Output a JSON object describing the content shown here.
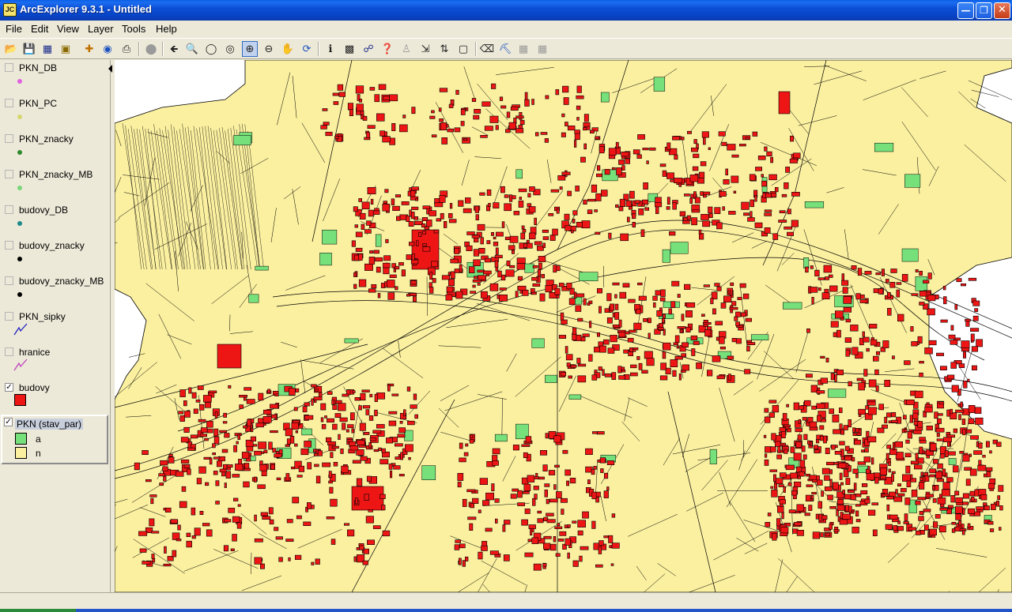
{
  "window": {
    "title": "ArcExplorer 9.3.1 - Untitled",
    "icon_text": "JC",
    "controls": {
      "minimize": "minimize",
      "maximize": "maximize",
      "close": "close"
    }
  },
  "menu": [
    "File",
    "Edit",
    "View",
    "Layer",
    "Tools",
    "Help"
  ],
  "toolbar": [
    "open-folder-icon",
    "save-icon",
    "save-as-icon",
    "layer-add-icon",
    "add-data-icon",
    "internet-icon",
    "print-icon",
    "stop-icon",
    "back-icon",
    "zoom-full-icon",
    "zoom-layer-icon",
    "zoom-selection-icon",
    "zoom-in-icon",
    "zoom-out-icon",
    "pan-icon",
    "refresh-icon",
    "identify-icon",
    "select-icon",
    "find-icon",
    "query-icon",
    "locate-icon",
    "measure-icon",
    "hyperlink-icon",
    "buffer-icon",
    "clear-icon",
    "zoom-tool-icon",
    "grid-icon",
    "table-icon"
  ],
  "colors": {
    "parcel_a": "#76e07a",
    "parcel_n": "#fbf0a0",
    "building": "#ee1515",
    "outline": "#000000"
  },
  "layers": [
    {
      "name": "PKN_DB",
      "checked": false,
      "symbol": "dot",
      "color": "#e060e0"
    },
    {
      "name": "PKN_PC",
      "checked": false,
      "symbol": "dot",
      "color": "#d6d670"
    },
    {
      "name": "PKN_znacky",
      "checked": false,
      "symbol": "dot",
      "color": "#2c8a2c"
    },
    {
      "name": "PKN_znacky_MB",
      "checked": false,
      "symbol": "dot",
      "color": "#7ad67a"
    },
    {
      "name": "budovy_DB",
      "checked": false,
      "symbol": "dot",
      "color": "#1a8a8a"
    },
    {
      "name": "budovy_znacky",
      "checked": false,
      "symbol": "dot",
      "color": "#000000"
    },
    {
      "name": "budovy_znacky_MB",
      "checked": false,
      "symbol": "dot",
      "color": "#000000"
    },
    {
      "name": "PKN_sipky",
      "checked": false,
      "symbol": "line",
      "color": "#2020c0"
    },
    {
      "name": "hranice",
      "checked": false,
      "symbol": "line",
      "color": "#c040c0"
    },
    {
      "name": "budovy",
      "checked": true,
      "symbol": "square",
      "color": "#ee1515"
    }
  ],
  "active_layer": {
    "name": "PKN (stav_par)",
    "checked": true,
    "classes": [
      {
        "label": "a",
        "color": "#76e07a"
      },
      {
        "label": "n",
        "color": "#fbf0a0"
      }
    ]
  },
  "toc": {
    "collapse": "collapse-panel"
  }
}
